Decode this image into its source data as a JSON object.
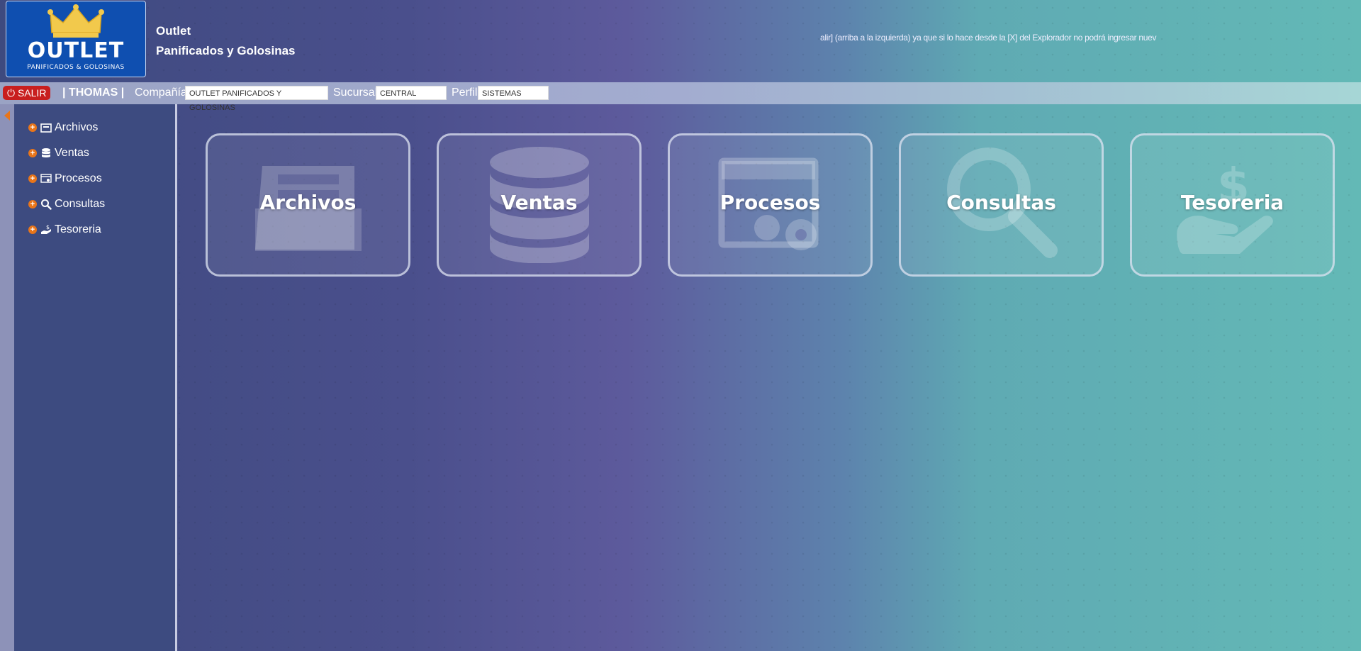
{
  "logo": {
    "brand": "OUTLET",
    "tagline": "PANIFICADOS & GOLOSINAS",
    "icon": "crown-icon"
  },
  "header": {
    "title_line1": "Outlet",
    "title_line2": "Panificados y Golosinas",
    "marquee": "alir] (arriba a la izquierda) ya que si lo hace desde la [X] del Explorador no podrá ingresar nuev"
  },
  "infobar": {
    "exit_label": "SALIR",
    "user": "| THOMAS |",
    "company_label": "Compañía",
    "company_value": "OUTLET PANIFICADOS Y GOLOSINAS",
    "branch_label": "Sucursal",
    "branch_value": "CENTRAL",
    "profile_label": "Perfil",
    "profile_value": "SISTEMAS"
  },
  "sidebar": {
    "items": [
      {
        "label": "Archivos",
        "icon": "archive-icon"
      },
      {
        "label": "Ventas",
        "icon": "database-icon"
      },
      {
        "label": "Procesos",
        "icon": "gears-icon"
      },
      {
        "label": "Consultas",
        "icon": "search-icon"
      },
      {
        "label": "Tesoreria",
        "icon": "money-hand-icon"
      }
    ]
  },
  "tiles": [
    {
      "label": "Archivos",
      "icon": "archive-icon"
    },
    {
      "label": "Ventas",
      "icon": "database-icon"
    },
    {
      "label": "Procesos",
      "icon": "gears-icon"
    },
    {
      "label": "Consultas",
      "icon": "search-icon"
    },
    {
      "label": "Tesoreria",
      "icon": "money-hand-icon"
    }
  ],
  "colors": {
    "accent": "#e8751a",
    "exit": "#c81e1e",
    "sidebar": "#3d4b80",
    "logo_bg": "#0f4fb0"
  }
}
